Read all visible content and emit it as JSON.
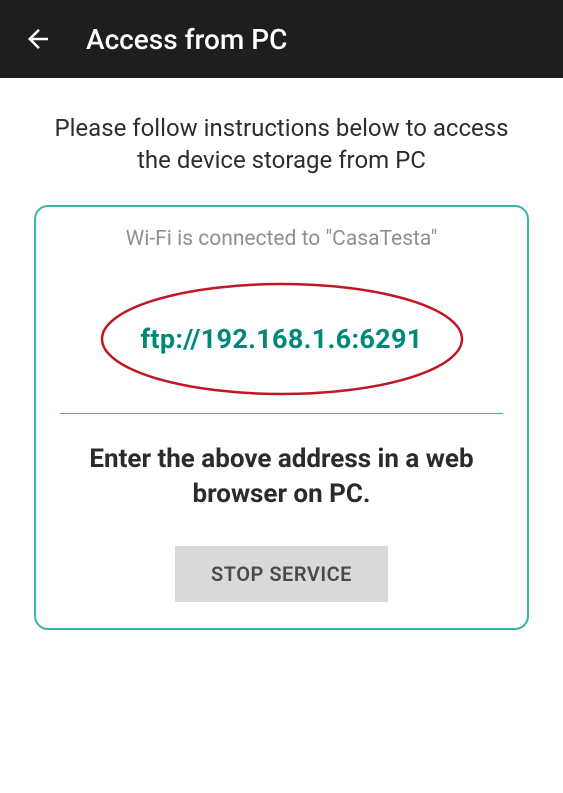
{
  "header": {
    "title": "Access from PC"
  },
  "instructions": "Please follow instructions below to access the device storage from PC",
  "card": {
    "wifi_status": "Wi-Fi is connected to \"CasaTesta\"",
    "ftp_address": "ftp://192.168.1.6:6291",
    "hint": "Enter the above address in a web browser on PC.",
    "stop_button": "STOP SERVICE"
  },
  "colors": {
    "accent": "#00897b",
    "card_border": "#3ab5a5",
    "annotation": "#c01722"
  }
}
